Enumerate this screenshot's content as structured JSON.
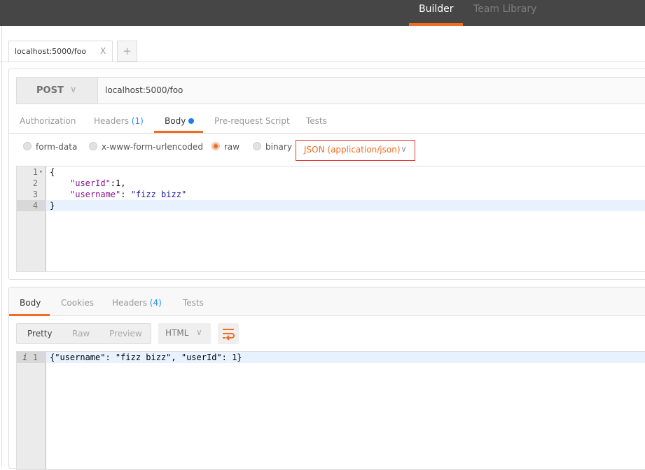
{
  "topbar": {
    "builder": "Builder",
    "team_library": "Team Library",
    "accent": "#f26b21"
  },
  "tabs": [
    {
      "label": "localhost:5000/foo",
      "close": "X"
    }
  ],
  "new_tab": "+",
  "request": {
    "method": "POST",
    "method_chevron": "∨",
    "url": "localhost:5000/foo",
    "tabs": {
      "authorization": "Authorization",
      "headers": "Headers",
      "headers_count": "(1)",
      "body": "Body",
      "prerequest": "Pre-request Script",
      "tests": "Tests"
    },
    "body_types": {
      "form_data": "form-data",
      "urlencoded": "x-www-form-urlencoded",
      "raw": "raw",
      "binary": "binary",
      "selected": "raw"
    },
    "content_type": "JSON (application/json)",
    "editor": {
      "line_numbers": [
        "1",
        "2",
        "3",
        "4"
      ],
      "fold_marker": "▾",
      "lines": [
        "{",
        "\"userId\"",
        ":1,",
        "\"username\"",
        ": ",
        "\"fizz bizz\"",
        "}"
      ]
    }
  },
  "response": {
    "tabs": {
      "body": "Body",
      "cookies": "Cookies",
      "headers": "Headers",
      "headers_count": "(4)",
      "tests": "Tests"
    },
    "format": {
      "pretty": "Pretty",
      "raw": "Raw",
      "preview": "Preview"
    },
    "language": "HTML",
    "language_chevron": "∨",
    "editor": {
      "line_marker": "i",
      "line_number": "1",
      "content": "{\"username\": \"fizz bizz\", \"userId\": 1}"
    }
  }
}
